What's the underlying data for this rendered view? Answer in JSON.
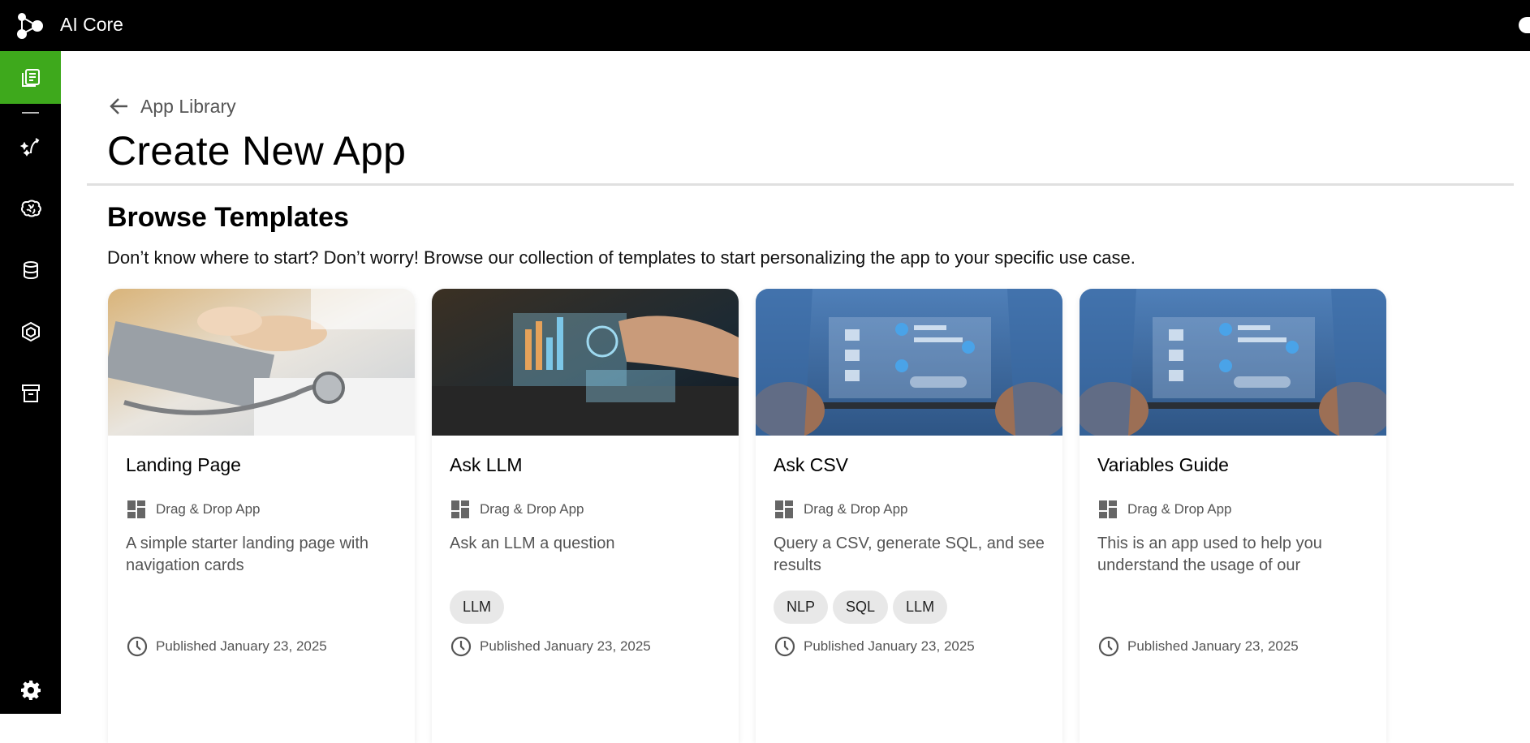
{
  "app": {
    "title": "AI Core"
  },
  "sidebar": {
    "items": [
      {
        "icon": "library-icon",
        "active": true
      },
      {
        "icon": "prompt-icon"
      },
      {
        "icon": "brain-icon"
      },
      {
        "icon": "database-icon"
      },
      {
        "icon": "cube-icon"
      },
      {
        "icon": "archive-icon"
      },
      {
        "icon": "gear-icon"
      }
    ],
    "accent_color": "#3ea91c"
  },
  "breadcrumb": {
    "label": "App Library"
  },
  "page": {
    "title": "Create New App"
  },
  "templates": {
    "heading": "Browse Templates",
    "description": "Don’t know where to start? Don’t worry! Browse our collection of templates to start personalizing the app to your specific use case.",
    "cards": [
      {
        "title": "Landing Page",
        "type": "Drag & Drop App",
        "description": "A simple starter landing page with navigation cards",
        "tags": [],
        "published": "Published January 23, 2025"
      },
      {
        "title": "Ask LLM",
        "type": "Drag & Drop App",
        "description": "Ask an LLM a question",
        "tags": [
          "LLM"
        ],
        "published": "Published January 23, 2025"
      },
      {
        "title": "Ask CSV",
        "type": "Drag & Drop App",
        "description": "Query a CSV, generate SQL, and see results",
        "tags": [
          "NLP",
          "SQL",
          "LLM"
        ],
        "published": "Published January 23, 2025"
      },
      {
        "title": "Variables Guide",
        "type": "Drag & Drop App",
        "description": "This is an app used to help you understand the usage of our",
        "tags": [],
        "published": "Published January 23, 2025"
      }
    ]
  }
}
